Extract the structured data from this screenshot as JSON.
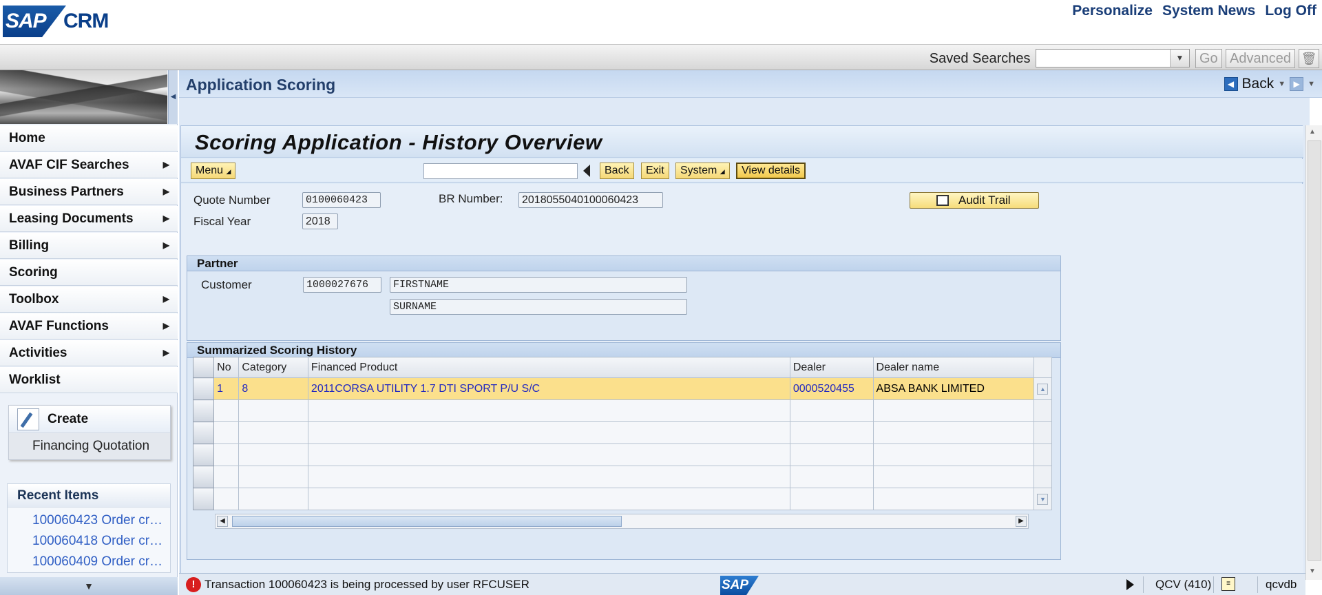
{
  "brand": {
    "logo_text": "SAP",
    "product": "CRM",
    "accent": "#0a3f8a"
  },
  "top_links": [
    "Personalize",
    "System News",
    "Log Off"
  ],
  "search_bar": {
    "saved_searches_label": "Saved Searches",
    "go_label": "Go",
    "advanced_label": "Advanced",
    "combo_value": ""
  },
  "nav": {
    "items": [
      {
        "label": "Home",
        "has_submenu": false
      },
      {
        "label": "AVAF CIF Searches",
        "has_submenu": true
      },
      {
        "label": "Business Partners",
        "has_submenu": true
      },
      {
        "label": "Leasing Documents",
        "has_submenu": true
      },
      {
        "label": "Billing",
        "has_submenu": true
      },
      {
        "label": "Scoring",
        "has_submenu": false
      },
      {
        "label": "Toolbox",
        "has_submenu": true
      },
      {
        "label": "AVAF Functions",
        "has_submenu": true
      },
      {
        "label": "Activities",
        "has_submenu": true
      },
      {
        "label": "Worklist",
        "has_submenu": false
      }
    ],
    "create": {
      "title": "Create",
      "link": "Financing Quotation"
    },
    "recent": {
      "title": "Recent Items",
      "items": [
        "100060423 Order cr…",
        "100060418 Order cr…",
        "100060409 Order cr…"
      ]
    }
  },
  "work_header": {
    "title": "Application Scoring",
    "back_label": "Back"
  },
  "gui": {
    "title": "Scoring Application - History Overview",
    "toolbar": {
      "menu": "Menu",
      "command_value": "",
      "back": "Back",
      "exit": "Exit",
      "system": "System",
      "view_details": "View details"
    },
    "fields": {
      "quote_number_label": "Quote Number",
      "quote_number": "0100060423",
      "br_number_label": "BR Number:",
      "br_number": "2018055040100060423",
      "fiscal_year_label": "Fiscal Year",
      "fiscal_year": "2018",
      "audit_trail": "Audit Trail"
    },
    "partner": {
      "title": "Partner",
      "customer_label": "Customer",
      "customer_id": "1000027676",
      "firstname": "FIRSTNAME",
      "surname": "SURNAME"
    },
    "history": {
      "title": "Summarized Scoring History",
      "columns": [
        "No",
        "Category",
        "Financed Product",
        "Dealer",
        "Dealer name"
      ],
      "rows": [
        {
          "no": "1",
          "category": "8",
          "product": "2011CORSA UTILITY 1.7 DTI SPORT P/U S/C",
          "dealer": "0000520455",
          "dealer_name": "ABSA BANK LIMITED"
        }
      ],
      "empty_rows": 5,
      "highlight_color": "#fbe08c"
    }
  },
  "status": {
    "message": "Transaction 100060423 is being processed by user RFCUSER",
    "logo_text": "SAP",
    "system": "QCV (410)",
    "server": "qcvdb",
    "error_color": "#d81e1e"
  }
}
